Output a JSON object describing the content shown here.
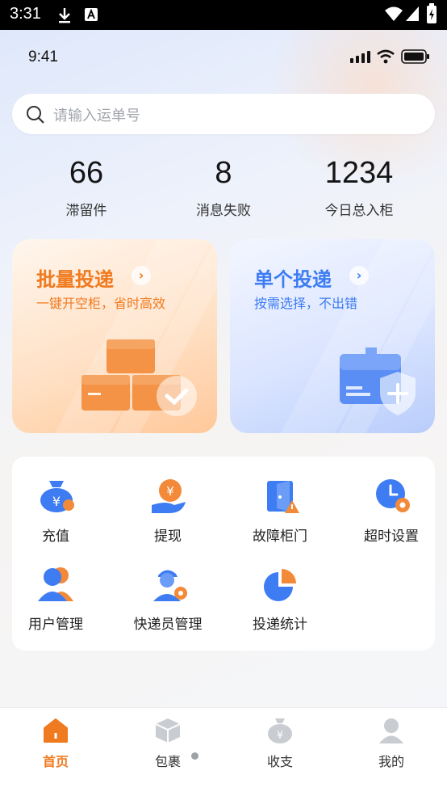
{
  "system_status": {
    "time": "3:31"
  },
  "phone_status": {
    "time": "9:41"
  },
  "search": {
    "placeholder": "请输入运单号"
  },
  "stats": [
    {
      "value": "66",
      "label": "滞留件"
    },
    {
      "value": "8",
      "label": "消息失败"
    },
    {
      "value": "1234",
      "label": "今日总入柜"
    }
  ],
  "cards": {
    "batch": {
      "title": "批量投递",
      "subtitle": "一键开空柜，省时高效",
      "color": "#f07a1f"
    },
    "single": {
      "title": "单个投递",
      "subtitle": "按需选择，不出错",
      "color": "#3d7cf2"
    }
  },
  "functions": [
    {
      "label": "充值",
      "icon": "money-bag-icon"
    },
    {
      "label": "提现",
      "icon": "coin-hand-icon"
    },
    {
      "label": "故障柜门",
      "icon": "fault-door-icon"
    },
    {
      "label": "超时设置",
      "icon": "clock-gear-icon"
    },
    {
      "label": "用户管理",
      "icon": "users-icon"
    },
    {
      "label": "快递员管理",
      "icon": "courier-icon"
    },
    {
      "label": "投递统计",
      "icon": "pie-chart-icon"
    }
  ],
  "tabs": [
    {
      "label": "首页",
      "icon": "home-icon",
      "active": true
    },
    {
      "label": "包裹",
      "icon": "box-icon",
      "active": false
    },
    {
      "label": "收支",
      "icon": "money-bag-icon",
      "active": false
    },
    {
      "label": "我的",
      "icon": "person-icon",
      "active": false
    }
  ],
  "colors": {
    "accent_orange": "#f07a1f",
    "accent_blue": "#3d7cf2"
  }
}
